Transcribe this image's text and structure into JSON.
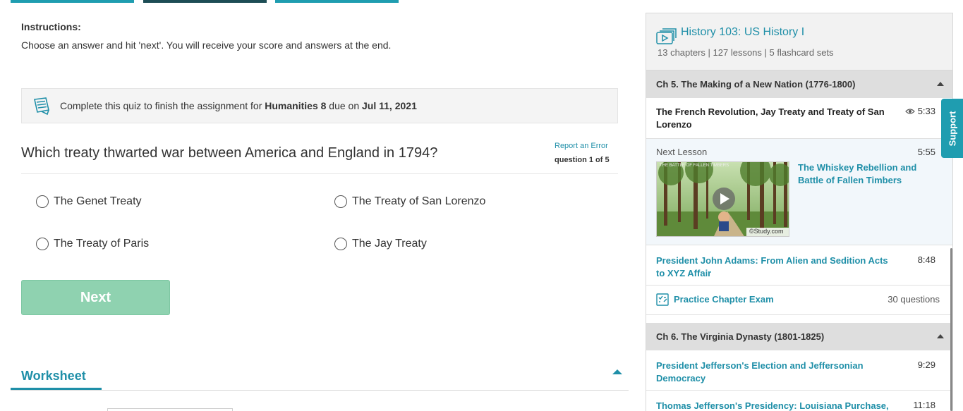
{
  "quiz": {
    "instructions_title": "Instructions:",
    "instructions_text": "Choose an answer and hit 'next'. You will receive your score and answers at the end.",
    "assignment": {
      "prefix": "Complete this quiz to finish the assignment for ",
      "course": "Humanities 8",
      "middle": " due on ",
      "due": "Jul 11, 2021"
    },
    "question": "Which treaty thwarted war between America and England in 1794?",
    "report_error": "Report an Error",
    "question_count": "question 1 of 5",
    "options": [
      "The Genet Treaty",
      "The Treaty of San Lorenzo",
      "The Treaty of Paris",
      "The Jay Treaty"
    ],
    "next_label": "Next"
  },
  "worksheet": {
    "title": "Worksheet"
  },
  "sidebar": {
    "course_title": "History 103: US History I",
    "course_meta": "13 chapters | 127 lessons | 5 flashcard sets",
    "chapters": [
      {
        "title": "Ch 5. The Making of a New Nation (1776-1800)",
        "current_lesson": {
          "title": "The French Revolution, Jay Treaty and Treaty of San Lorenzo",
          "duration": "5:33"
        },
        "next_lesson": {
          "label": "Next Lesson",
          "duration": "5:55",
          "title": "The Whiskey Rebellion and Battle of Fallen Timbers",
          "thumb_caption": "THE BATTLE OF FALLEN TIMBERS",
          "thumb_watermark": "©Study.com"
        },
        "lessons": [
          {
            "title": "President John Adams: From Alien and Sedition Acts to XYZ Affair",
            "duration": "8:48"
          }
        ],
        "exam": {
          "title": "Practice Chapter Exam",
          "count": "30 questions"
        }
      },
      {
        "title": "Ch 6. The Virginia Dynasty (1801-1825)",
        "lessons": [
          {
            "title": "President Jefferson's Election and Jeffersonian Democracy",
            "duration": "9:29"
          },
          {
            "title": "Thomas Jefferson's Presidency: Louisiana Purchase,",
            "duration": "11:18"
          }
        ]
      }
    ]
  },
  "support_label": "Support",
  "colors": {
    "accent": "#1f8fa8",
    "next_button": "#8fd2b0",
    "support": "#1f9db0"
  }
}
